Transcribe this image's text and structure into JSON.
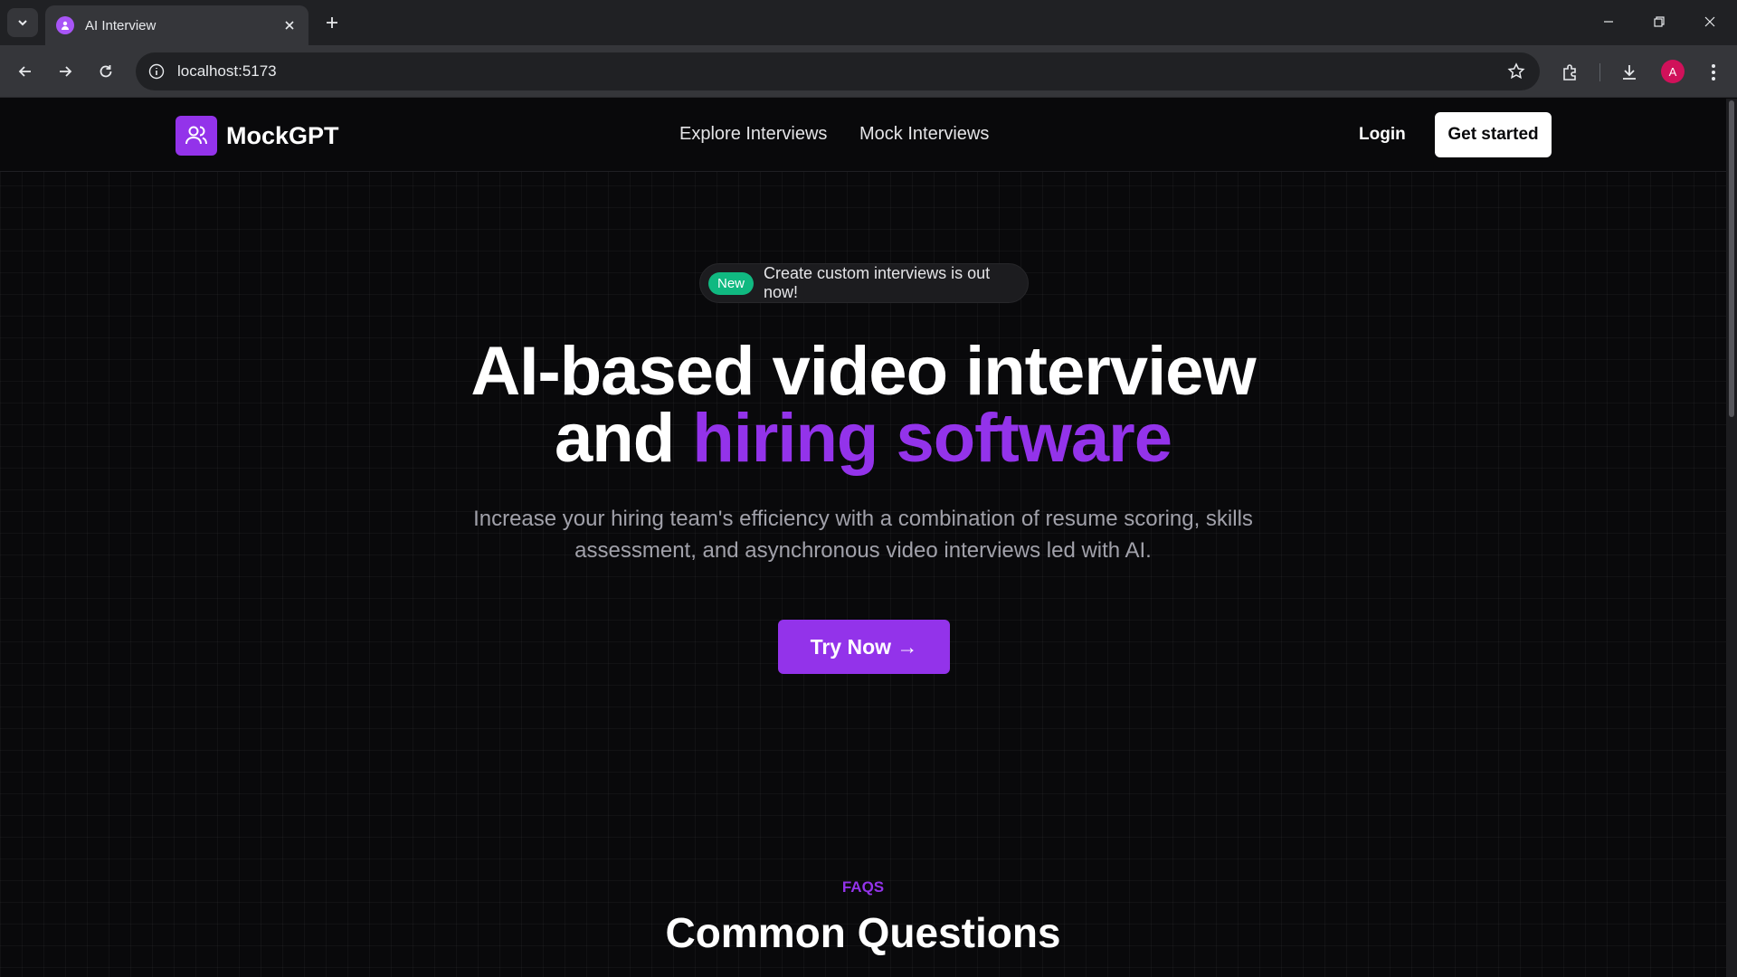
{
  "browser": {
    "tab_title": "AI Interview",
    "url": "localhost:5173",
    "profile_initial": "A"
  },
  "nav": {
    "brand": "MockGPT",
    "links": [
      "Explore Interviews",
      "Mock Interviews"
    ],
    "login": "Login",
    "get_started": "Get started"
  },
  "hero": {
    "badge": "New",
    "announcement": "Create custom interviews is out now!",
    "title_line1": "AI-based video interview",
    "title_line2_plain": "and ",
    "title_line2_accent": "hiring software",
    "subtitle": "Increase your hiring team's efficiency with a combination of resume scoring, skills assessment, and asynchronous video interviews led with AI.",
    "cta": "Try Now →"
  },
  "faq": {
    "label": "FAQS",
    "title": "Common Questions"
  },
  "colors": {
    "accent": "#9333ea",
    "badge": "#10b981",
    "background": "#09090b"
  }
}
